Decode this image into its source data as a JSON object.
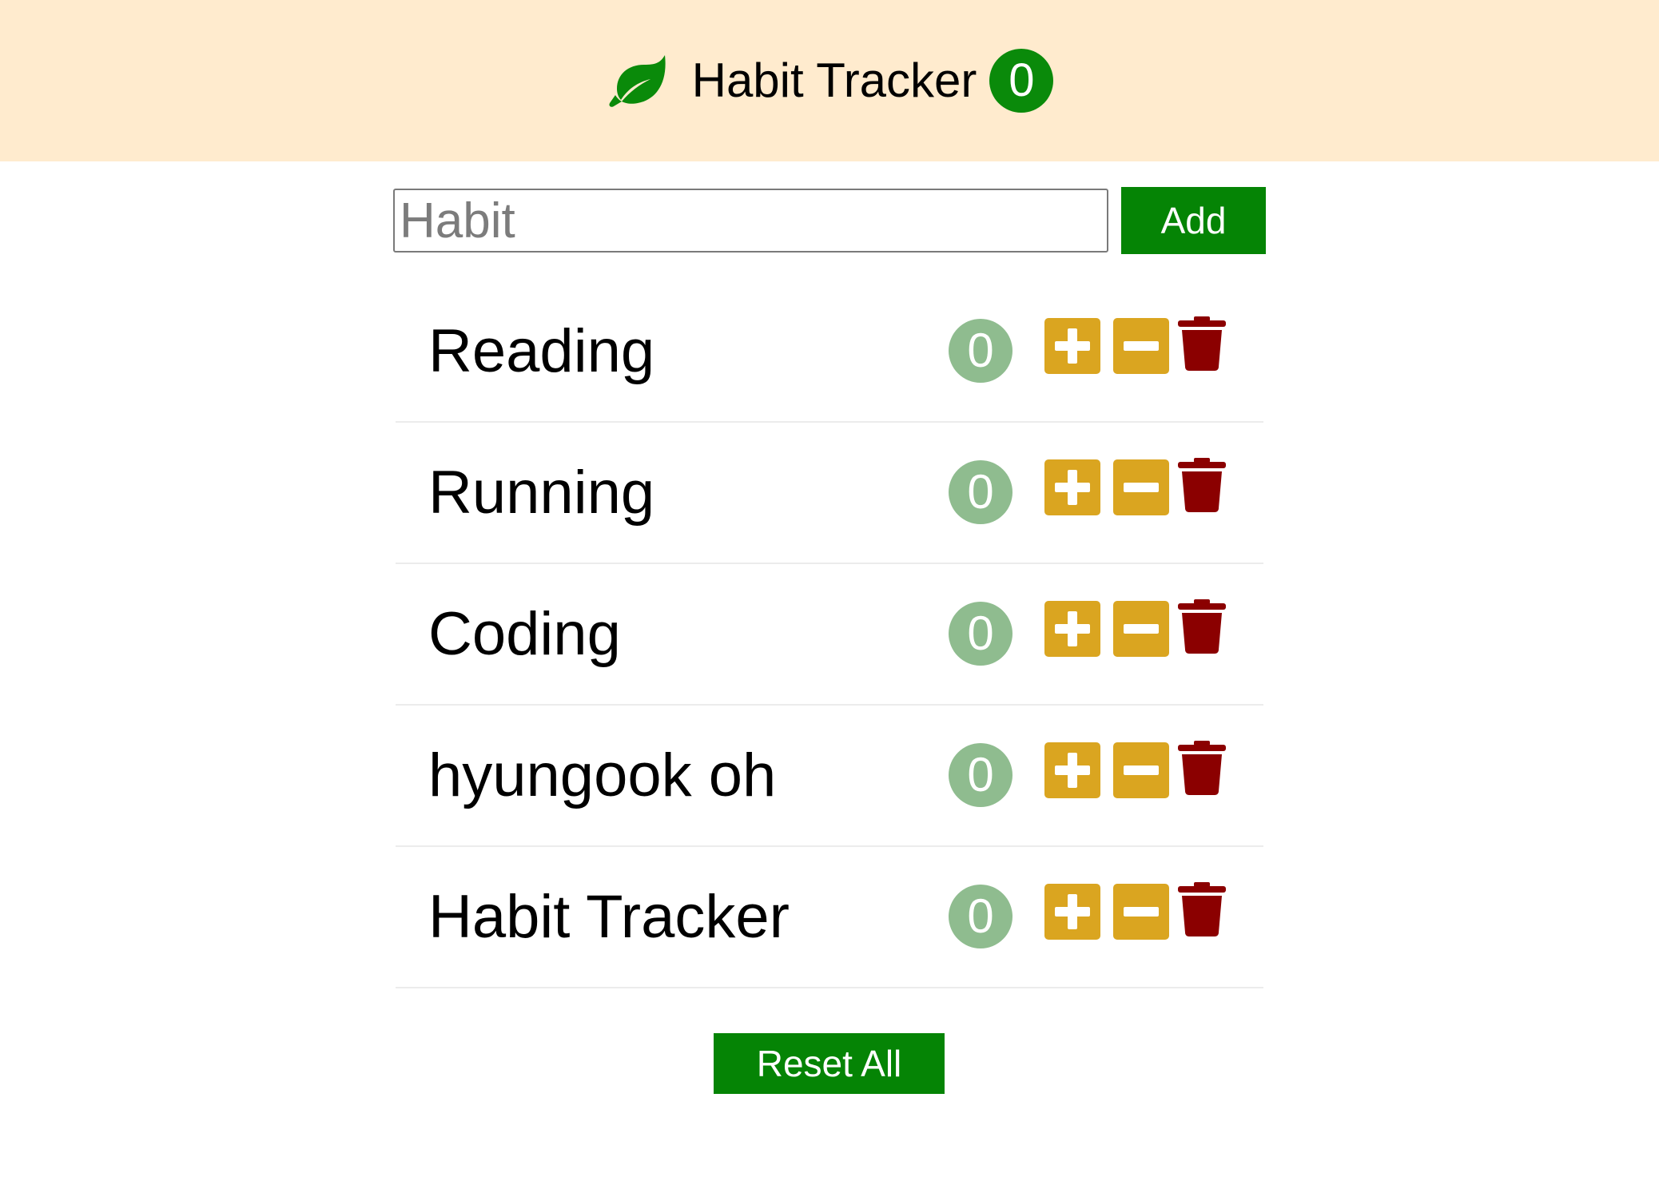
{
  "header": {
    "title": "Habit Tracker",
    "total_count": "0",
    "logo_icon": "leaf-icon",
    "background_color": "#ffebce",
    "badge_color": "#0a8a0a"
  },
  "form": {
    "input_value": "",
    "input_placeholder": "Habit",
    "add_label": "Add"
  },
  "habits": [
    {
      "name": "Reading",
      "count": "0"
    },
    {
      "name": "Running",
      "count": "0"
    },
    {
      "name": "Coding",
      "count": "0"
    },
    {
      "name": "hyungook oh",
      "count": "0"
    },
    {
      "name": "Habit Tracker",
      "count": "0"
    }
  ],
  "row_actions": {
    "increase_icon": "plus-square-icon",
    "decrease_icon": "minus-square-icon",
    "delete_icon": "trash-icon"
  },
  "colors": {
    "accent_green": "#058405",
    "count_badge": "#8fbc8f",
    "action_yellow": "#daa520",
    "delete_red": "#8b0000"
  },
  "footer": {
    "reset_label": "Reset All"
  }
}
